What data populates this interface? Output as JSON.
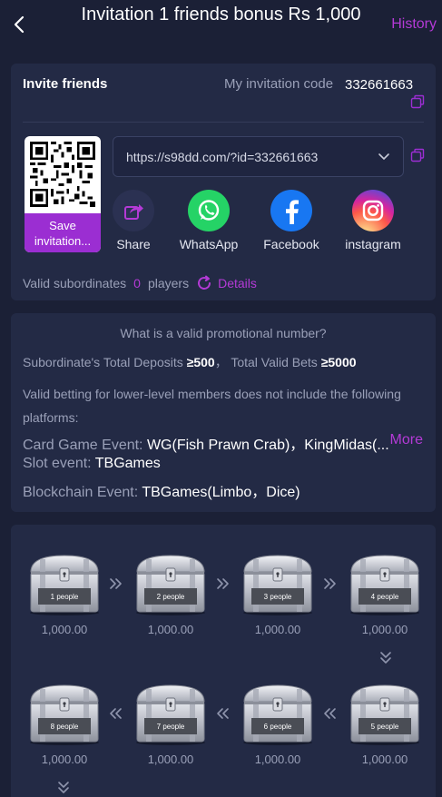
{
  "header": {
    "title": "Invitation 1 friends bonus Rs 1,000",
    "history_label": "History"
  },
  "invite": {
    "title": "Invite friends",
    "code_label": "My invitation code",
    "code_value": "332661663",
    "save_label": "Save invitation...",
    "link": "https://s98dd.com/?id=332661663",
    "share_items": [
      {
        "label": "Share",
        "icon": "share-icon",
        "color": "#2b3152"
      },
      {
        "label": "WhatsApp",
        "icon": "whatsapp-icon",
        "color": "#25d366"
      },
      {
        "label": "Facebook",
        "icon": "facebook-icon",
        "color": "#1877f2"
      },
      {
        "label": "instagram",
        "icon": "instagram-icon",
        "color": "#e1306c"
      }
    ],
    "valid_label": "Valid subordinates",
    "valid_count": "0",
    "valid_unit": "players",
    "details_label": "Details"
  },
  "rules": {
    "title": "What is a valid promotional number?",
    "deposits_label": "Subordinate's Total Deposits",
    "deposits_value": "≥500",
    "bets_label": "Total Valid Bets",
    "bets_value": "≥5000",
    "description": "Valid betting for lower-level members does not include the following platforms:",
    "events": [
      {
        "label": "Card Game Event:",
        "value": "WG(Fish Prawn Crab)，KingMidas(..."
      },
      {
        "label": "Slot event:",
        "value": "TBGames"
      },
      {
        "label": "Blockchain Event:",
        "value": "TBGames(Limbo，Dice)"
      }
    ],
    "more_label": "More"
  },
  "rewards": {
    "chests": [
      {
        "label": "1 people",
        "amount": "1,000.00"
      },
      {
        "label": "2 people",
        "amount": "1,000.00"
      },
      {
        "label": "3 people",
        "amount": "1,000.00"
      },
      {
        "label": "4 people",
        "amount": "1,000.00"
      },
      {
        "label": "5 people",
        "amount": "1,000.00"
      },
      {
        "label": "6 people",
        "amount": "1,000.00"
      },
      {
        "label": "7 people",
        "amount": "1,000.00"
      },
      {
        "label": "8 people",
        "amount": "1,000.00"
      }
    ]
  },
  "colors": {
    "background": "#1b2036",
    "card": "#232a45",
    "accent": "#b43ad6",
    "save_button": "#9b2ed2"
  }
}
